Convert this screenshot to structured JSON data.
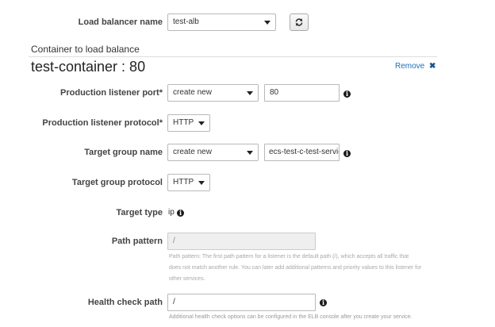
{
  "load_balancer": {
    "label": "Load balancer name",
    "value": "test-alb"
  },
  "section_title": "Container to load balance",
  "container": {
    "title": "test-container : 80",
    "remove_label": "Remove"
  },
  "production_listener_port": {
    "label": "Production listener port*",
    "select": "create new",
    "port": "80"
  },
  "production_listener_protocol": {
    "label": "Production listener protocol*",
    "value": "HTTP"
  },
  "target_group_name": {
    "label": "Target group name",
    "select": "create new",
    "value": "ecs-test-c-test-service"
  },
  "target_group_protocol": {
    "label": "Target group protocol",
    "value": "HTTP"
  },
  "target_type": {
    "label": "Target type",
    "value": "ip"
  },
  "path_pattern": {
    "label": "Path pattern",
    "value": "/",
    "help_lines": [
      "Path pattern: The first path pattern for a listener is the default path (/), which accepts all traffic that",
      "does not match another rule. You can later add additional patterns and priority values to this listener for",
      "other services."
    ]
  },
  "health_check": {
    "label": "Health check path",
    "value": "/",
    "help": "Additional health check options can be configured in the ELB console after you create your service."
  },
  "icons": {
    "info": "info-icon",
    "refresh": "refresh-icon",
    "remove": "close-icon",
    "dropdown": "chevron-down-icon"
  }
}
